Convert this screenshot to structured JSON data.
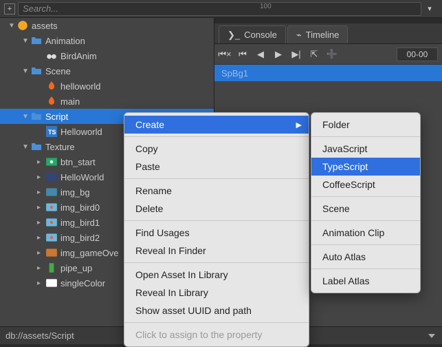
{
  "search": {
    "placeholder": "Search..."
  },
  "tree": {
    "root": "assets",
    "items": [
      {
        "label": "Animation",
        "type": "folder"
      },
      {
        "label": "BirdAnim",
        "type": "anim"
      },
      {
        "label": "Scene",
        "type": "folder"
      },
      {
        "label": "helloworld",
        "type": "fire"
      },
      {
        "label": "main",
        "type": "fire"
      },
      {
        "label": "Script",
        "type": "folder",
        "selected": true
      },
      {
        "label": "Helloworld",
        "type": "ts"
      },
      {
        "label": "Texture",
        "type": "folder"
      },
      {
        "label": "btn_start",
        "type": "img"
      },
      {
        "label": "HelloWorld",
        "type": "img"
      },
      {
        "label": "img_bg",
        "type": "img"
      },
      {
        "label": "img_bird0",
        "type": "img"
      },
      {
        "label": "img_bird1",
        "type": "img"
      },
      {
        "label": "img_bird2",
        "type": "img"
      },
      {
        "label": "img_gameOve",
        "type": "img"
      },
      {
        "label": "pipe_up",
        "type": "img"
      },
      {
        "label": "singleColor",
        "type": "img"
      }
    ]
  },
  "status_path": "db://assets/Script",
  "tabs": {
    "console": "Console",
    "timeline": "Timeline"
  },
  "timeline": {
    "timecode": "00-00",
    "node": "SpBg1",
    "ruler_tick": "100"
  },
  "context_menu": {
    "create": "Create",
    "copy": "Copy",
    "paste": "Paste",
    "rename": "Rename",
    "delete": "Delete",
    "find_usages": "Find Usages",
    "reveal_finder": "Reveal In Finder",
    "open_library": "Open Asset In Library",
    "reveal_library": "Reveal In Library",
    "show_uuid": "Show asset UUID and path",
    "assign_prop": "Click to assign to the property"
  },
  "create_submenu": {
    "folder": "Folder",
    "javascript": "JavaScript",
    "typescript": "TypeScript",
    "coffeescript": "CoffeeScript",
    "scene": "Scene",
    "animation_clip": "Animation Clip",
    "auto_atlas": "Auto Atlas",
    "label_atlas": "Label Atlas"
  }
}
